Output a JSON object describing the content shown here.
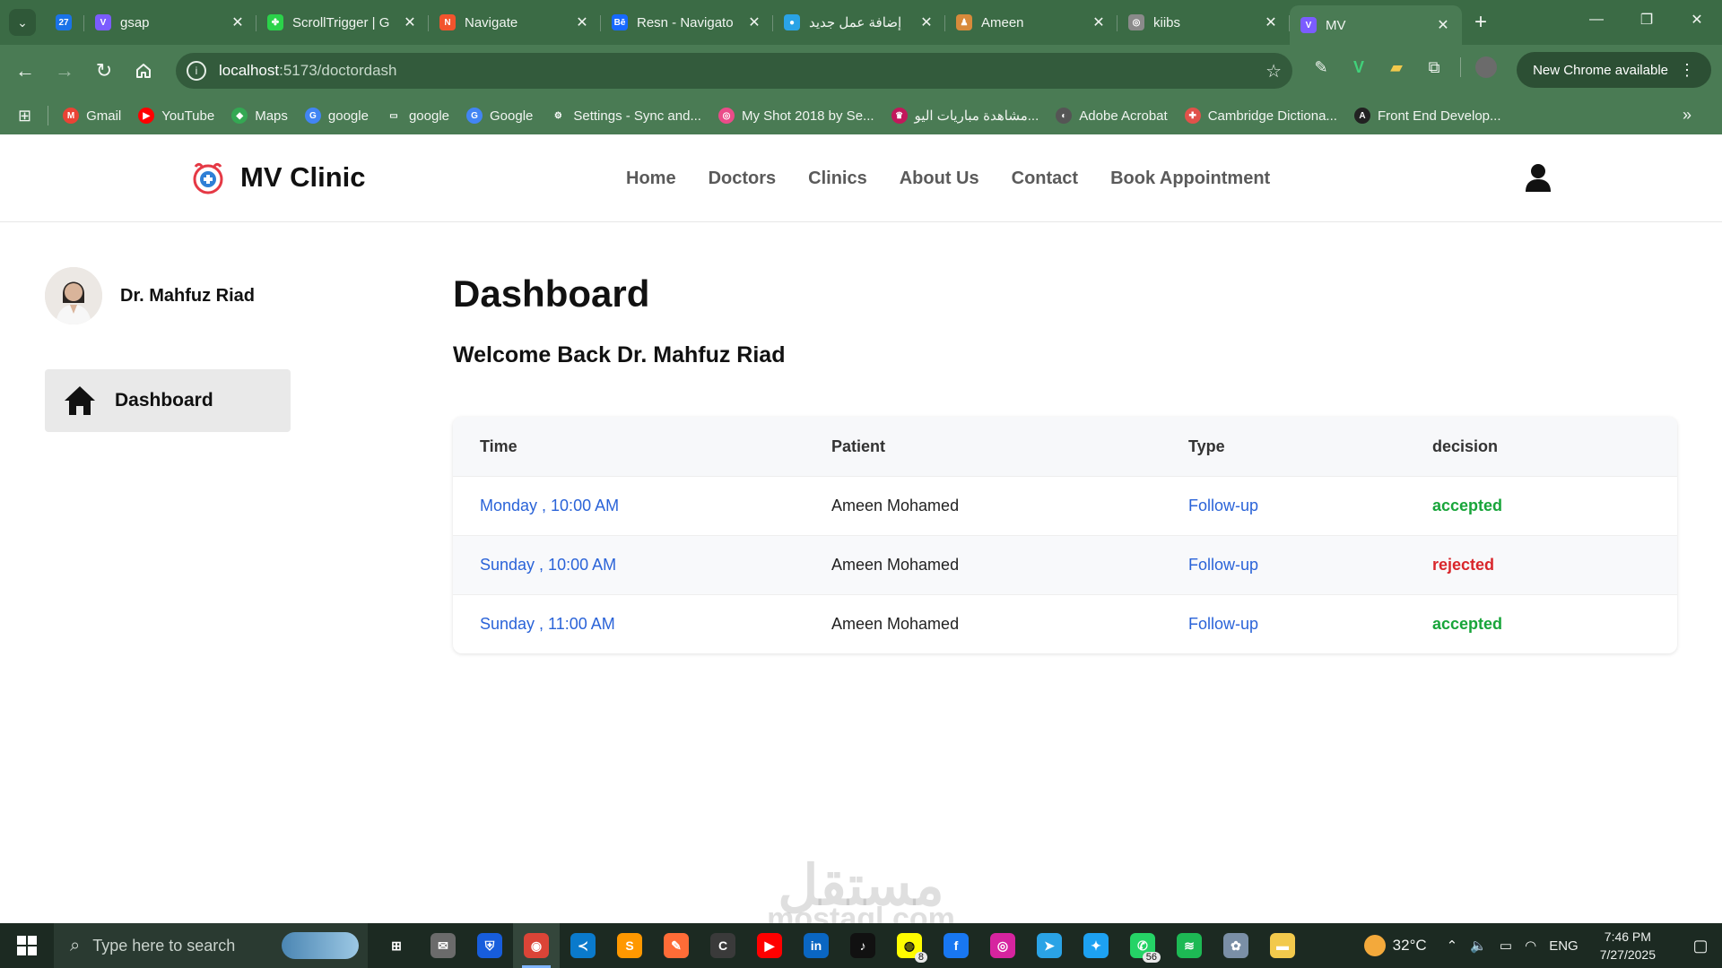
{
  "browser": {
    "tabs": [
      {
        "title": "",
        "favicon_color": "#1a73e8",
        "favicon_text": "27",
        "first": true
      },
      {
        "title": "gsap",
        "favicon_color": "#7b5cff",
        "favicon_text": "V"
      },
      {
        "title": "ScrollTrigger | G",
        "favicon_color": "#2bd24a",
        "favicon_text": "✤"
      },
      {
        "title": "Navigate",
        "favicon_color": "#f2542d",
        "favicon_text": "N"
      },
      {
        "title": "Resn - Navigato",
        "favicon_color": "#1769ff",
        "favicon_text": "Bē"
      },
      {
        "title": "إضافة عمل جديد",
        "favicon_color": "#2aa3e6",
        "favicon_text": "●"
      },
      {
        "title": "Ameen",
        "favicon_color": "#d88a3b",
        "favicon_text": "♟"
      },
      {
        "title": "kiibs",
        "favicon_color": "#8a8a8a",
        "favicon_text": "◎"
      },
      {
        "title": "MV",
        "favicon_color": "#7b5cff",
        "favicon_text": "V",
        "active": true
      }
    ],
    "new_tab": "+",
    "window_controls": {
      "minimize": "—",
      "restore": "❐",
      "close": "✕"
    },
    "url_host": "localhost",
    "url_path": ":5173/doctordash",
    "update_label": "New Chrome available",
    "bookmarks": [
      {
        "label": "Gmail",
        "color": "#ea4335",
        "glyph": "M"
      },
      {
        "label": "YouTube",
        "color": "#ff0000",
        "glyph": "▶"
      },
      {
        "label": "Maps",
        "color": "#34a853",
        "glyph": "◆"
      },
      {
        "label": "google",
        "color": "#4285f4",
        "glyph": "G"
      },
      {
        "label": "google",
        "color": "transparent",
        "glyph": "▭"
      },
      {
        "label": "Google",
        "color": "#4285f4",
        "glyph": "G"
      },
      {
        "label": "Settings - Sync and...",
        "color": "transparent",
        "glyph": "⚙"
      },
      {
        "label": "My Shot 2018 by Se...",
        "color": "#ea4c89",
        "glyph": "◎"
      },
      {
        "label": "مشاهدة مباريات اليو...",
        "color": "#c2185b",
        "glyph": "♛"
      },
      {
        "label": "Adobe Acrobat",
        "color": "#555555",
        "glyph": "◐"
      },
      {
        "label": "Cambridge Dictiona...",
        "color": "#e0524a",
        "glyph": "✚"
      },
      {
        "label": "Front End Develop...",
        "color": "#222222",
        "glyph": "A"
      }
    ]
  },
  "site": {
    "brand": "MV Clinic",
    "nav": [
      "Home",
      "Doctors",
      "Clinics",
      "About Us",
      "Contact",
      "Book Appointment"
    ]
  },
  "sidebar": {
    "doctor_name": "Dr. Mahfuz Riad",
    "items": [
      {
        "label": "Dashboard",
        "icon": "home-icon"
      }
    ]
  },
  "dashboard": {
    "title": "Dashboard",
    "welcome": "Welcome Back Dr. Mahfuz Riad",
    "columns": [
      "Time",
      "Patient",
      "Type",
      "decision"
    ],
    "rows": [
      {
        "time": "Monday , 10:00 AM",
        "patient": "Ameen Mohamed",
        "type": "Follow-up",
        "decision": "accepted",
        "status": "ok"
      },
      {
        "time": "Sunday , 10:00 AM",
        "patient": "Ameen Mohamed",
        "type": "Follow-up",
        "decision": "rejected",
        "status": "bad"
      },
      {
        "time": "Sunday , 11:00 AM",
        "patient": "Ameen Mohamed",
        "type": "Follow-up",
        "decision": "accepted",
        "status": "ok"
      }
    ]
  },
  "watermark": {
    "arabic": "مستقل",
    "latin": "mostaql.com"
  },
  "taskbar": {
    "search_placeholder": "Type here to search",
    "apps": [
      {
        "name": "task-view",
        "color": "transparent",
        "glyph": "⊞"
      },
      {
        "name": "mail",
        "color": "#6b6b6b",
        "glyph": "✉"
      },
      {
        "name": "bitwarden",
        "color": "#175ddc",
        "glyph": "⛨"
      },
      {
        "name": "chrome",
        "color": "#db4437",
        "glyph": "◉",
        "active": true
      },
      {
        "name": "vscode",
        "color": "#0a7acc",
        "glyph": "≺"
      },
      {
        "name": "sublime",
        "color": "#ff9800",
        "glyph": "S"
      },
      {
        "name": "postman",
        "color": "#ff6c37",
        "glyph": "✎"
      },
      {
        "name": "app-cp",
        "color": "#3a3a3a",
        "glyph": "C"
      },
      {
        "name": "youtube",
        "color": "#ff0000",
        "glyph": "▶"
      },
      {
        "name": "linkedin",
        "color": "#0a66c2",
        "glyph": "in"
      },
      {
        "name": "tiktok",
        "color": "#111111",
        "glyph": "♪"
      },
      {
        "name": "snapchat",
        "color": "#fffc00",
        "glyph": "◍",
        "badge": "8"
      },
      {
        "name": "facebook",
        "color": "#1877f2",
        "glyph": "f"
      },
      {
        "name": "instagram",
        "color": "#d6249f",
        "glyph": "◎"
      },
      {
        "name": "telegram",
        "color": "#2aa3e6",
        "glyph": "➤"
      },
      {
        "name": "twitter",
        "color": "#1da1f2",
        "glyph": "✦"
      },
      {
        "name": "whatsapp",
        "color": "#25d366",
        "glyph": "✆",
        "badge": "56"
      },
      {
        "name": "spotify",
        "color": "#1db954",
        "glyph": "≋"
      },
      {
        "name": "paint",
        "color": "#7a8fa6",
        "glyph": "✿"
      },
      {
        "name": "explorer",
        "color": "#f2c94c",
        "glyph": "▬"
      }
    ],
    "temperature": "32°C",
    "language": "ENG",
    "time": "7:46 PM",
    "date": "7/27/2025"
  }
}
